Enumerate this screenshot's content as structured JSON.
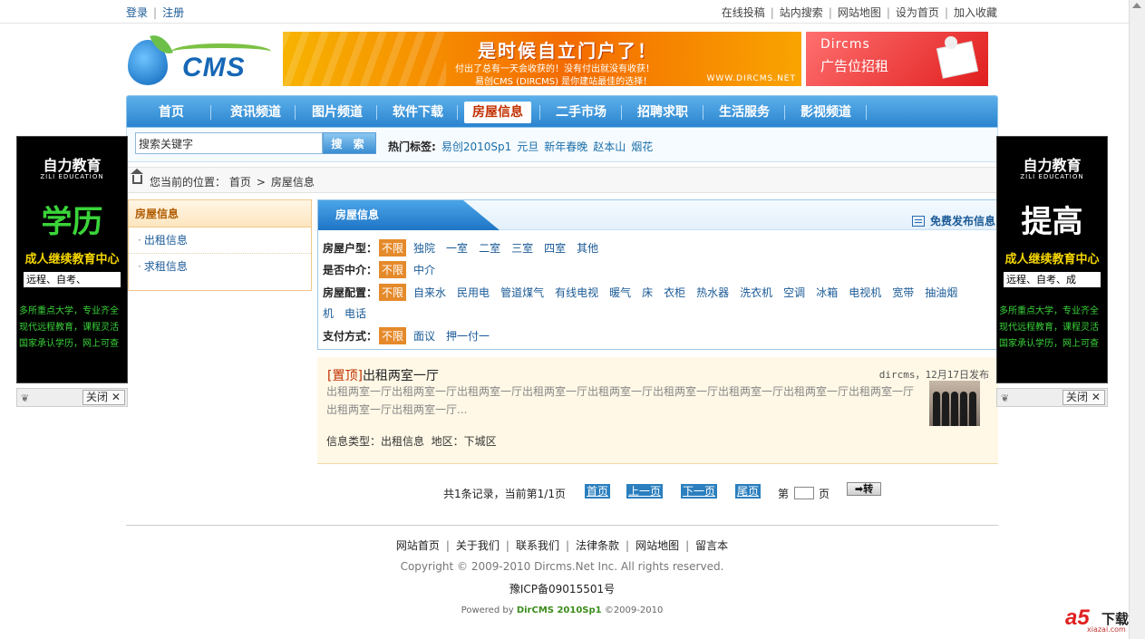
{
  "topbar": {
    "left_links": [
      "登录",
      "注册"
    ],
    "right_links": [
      "在线投稿",
      "站内搜索",
      "网站地图",
      "设为首页",
      "加入收藏"
    ]
  },
  "logo": {
    "text": "CMS"
  },
  "banner_main": {
    "title": "是时候自立门户了！",
    "line1": "付出了总有一天会收获的！没有付出就没有收获！",
    "line2": "易创CMS (DIRCMS) 是你建站最佳的选择！",
    "url": "WWW.DIRCMS.NET"
  },
  "banner_ad": {
    "brand": "Dircms",
    "text": "广告位招租"
  },
  "nav": {
    "items": [
      "首页",
      "资讯频道",
      "图片频道",
      "软件下载",
      "房屋信息",
      "二手市场",
      "招聘求职",
      "生活服务",
      "影视频道"
    ],
    "active": "房屋信息"
  },
  "search": {
    "placeholder": "搜索关键字",
    "button": "搜 索",
    "hot_label": "热门标签:",
    "hot_tags": [
      "易创2010Sp1",
      "元旦",
      "新年春晚",
      "赵本山",
      "烟花"
    ]
  },
  "breadcrumb": {
    "prefix": "您当前的位置：",
    "home": "首页",
    "current": "房屋信息"
  },
  "sidebar": {
    "title": "房屋信息",
    "items": [
      "出租信息",
      "求租信息"
    ]
  },
  "filter": {
    "tab": "房屋信息",
    "post_link": "免费发布信息",
    "any_label": "不限",
    "rows": [
      {
        "label": "房屋户型：",
        "options": [
          "独院",
          "一室",
          "二室",
          "三室",
          "四室",
          "其他"
        ]
      },
      {
        "label": "是否中介：",
        "options": [
          "中介"
        ]
      },
      {
        "label": "房屋配置：",
        "options": [
          "自来水",
          "民用电",
          "管道煤气",
          "有线电视",
          "暖气",
          "床",
          "衣柜",
          "热水器",
          "洗衣机",
          "空调",
          "冰箱",
          "电视机",
          "宽带",
          "抽油烟"
        ],
        "wrap": [
          "机",
          "电话"
        ]
      },
      {
        "label": "支付方式：",
        "options": [
          "面议",
          "押一付一"
        ]
      }
    ]
  },
  "listing": {
    "tag": "[置顶]",
    "title": "出租两室一厅",
    "meta": "dircms，12月17日发布",
    "desc": "出租两室一厅出租两室一厅出租两室一厅出租两室一厅出租两室一厅出租两室一厅出租两室一厅出租两室一厅出租两室一厅出租两室一厅出租两室一厅...",
    "type_label": "信息类型：出租信息",
    "area_label": "地区：下城区"
  },
  "pager": {
    "info": "共1条记录，当前第1/1页",
    "first": "首页",
    "prev": "上一页",
    "next": "下一页",
    "last": "尾页",
    "page_prefix": "第",
    "page_suffix": "页",
    "go": "➡转"
  },
  "footer": {
    "links": [
      "网站首页",
      "关于我们",
      "联系我们",
      "法律条款",
      "网站地图",
      "留言本"
    ],
    "copyright": "Copyright © 2009-2010 Dircms.Net Inc. All rights reserved.",
    "icp": "豫ICP备09015501号",
    "powered_prefix": "Powered by",
    "powered_brand": "DirCMS 2010Sp1",
    "powered_suffix": "©2009-2010"
  },
  "side_ads": {
    "brand": "自力教育",
    "brand_en": "ZILI EDUCATION",
    "left_big": "学历",
    "right_big": "提高",
    "center": "成人继续教育中心",
    "left_box": "远程、自考、",
    "right_box": "远程、自考、成",
    "lines": [
      "多所重点大学，专业齐全",
      "现代远程教育，课程灵活",
      "国家承认学历，网上可查"
    ],
    "close": "关闭"
  },
  "watermark": {
    "mark": "a5",
    "text": "下载",
    "url": "xiazai.com"
  },
  "colors": {
    "nav_blue": "#2b84cf",
    "active_red": "#c03000",
    "orange_tag": "#e58a2b",
    "listing_bg": "#fff8e6"
  }
}
